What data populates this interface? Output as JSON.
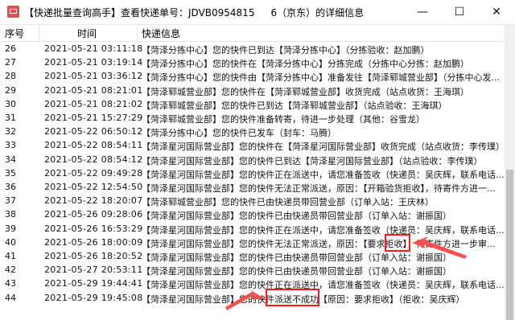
{
  "window": {
    "title_prefix": "【快递批量查询高手】查看快递单号：JDVB0954815",
    "title_suffix": "6（京东）的详细信息",
    "minimize": "—",
    "maximize": "☐",
    "close": "✕"
  },
  "columns": [
    "序号",
    "时间",
    "快递信息"
  ],
  "rows": [
    {
      "no": "26",
      "time": "2021-05-21 03:11:18",
      "info": "【菏泽分拣中心】您的快件已到达【菏泽分拣中心】（分拣验收：赵加鹏）"
    },
    {
      "no": "27",
      "time": "2021-05-21 03:19:14",
      "info": "【菏泽分拣中心】您的快件在【菏泽分拣中心】分拣完成（分拣中心分拣：赵加鹏）"
    },
    {
      "no": "28",
      "time": "2021-05-21 03:36:12",
      "info": "【菏泽分拣中心】您的快件由【菏泽分拣中心】准备发往【菏泽郓城营业部】（分拣中心发..."
    },
    {
      "no": "29",
      "time": "2021-05-21 08:21:01",
      "info": "【菏泽郓城营业部】您的快件在【菏泽郓城营业部】收货完成（站点收货：王海琪）"
    },
    {
      "no": "30",
      "time": "2021-05-21 08:21:02",
      "info": "【菏泽郓城营业部】您的快件已到达【菏泽郓城营业部】（站点验收：王海琪）"
    },
    {
      "no": "31",
      "time": "2021-05-21 15:27:29",
      "info": "【菏泽郓城营业部】您的快件准备转寄，待进一步处理（其他：谷雪龙）"
    },
    {
      "no": "32",
      "time": "2021-05-22 06:50:12",
      "info": "【菏泽分拣中心】您的快件已发车（封车：马腾）"
    },
    {
      "no": "33",
      "time": "2021-05-22 08:54:11",
      "info": "【菏泽星河国际营业部】您的快件在【菏泽星河国际营业部】收货完成（站点收货：李传璞）"
    },
    {
      "no": "34",
      "time": "2021-05-22 08:54:12",
      "info": "【菏泽星河国际营业部】您的快件已到达【菏泽星河国际营业部】（站点验收：李传璞）"
    },
    {
      "no": "35",
      "time": "2021-05-22 09:49:28",
      "info": "【菏泽星河国际营业部】您的快件正在派送中，请您准备签收（快递员：吴庆辉，联系电话..."
    },
    {
      "no": "36",
      "time": "2021-05-22 12:54:50",
      "info": "【菏泽星河国际营业部】您的快件无法正常派送，原因：【开箱验货拒收】，待寄件方进一..."
    },
    {
      "no": "37",
      "time": "2021-05-22 18:20:07",
      "info": "【菏泽郓城营业部】您的快件已由快递员带回营业部（订单入站：王庆林）"
    },
    {
      "no": "38",
      "time": "2021-05-26 09:28:06",
      "info": "【菏泽星河国际营业部】您的快件已由快递员带回营业部（订单入站：谢振国）"
    },
    {
      "no": "39",
      "time": "2021-05-26 16:53:29",
      "info": "【菏泽星河国际营业部】您的快件正在派送中，请您准备签收（快递员：吴庆辉，联系电话..."
    },
    {
      "no": "40",
      "time": "2021-05-26 18:00:09",
      "info": "【菏泽星河国际营业部】您的快件无法正常派送，原因：【要求拒收】，待寄件方进一步审..."
    },
    {
      "no": "41",
      "time": "2021-05-26 18:20:52",
      "info": "【菏泽星河国际营业部】您的快件已由快递员带回营业部（订单入站：谢振国）"
    },
    {
      "no": "42",
      "time": "2021-05-27 20:53:11",
      "info": "【菏泽星河国际营业部】您的快件已由快递员带回营业部（订单入站：谢振国）"
    },
    {
      "no": "43",
      "time": "2021-05-29 19:44:41",
      "info": "【菏泽星河国际营业部】您的快件正在派送中，请您准备签收（快递员：吴庆辉，联系电话..."
    },
    {
      "no": "44",
      "time": "2021-05-29 19:45:08",
      "info": "【菏泽星河国际营业部】您的快件派送不成功【原因：要求拒收】（拒收：吴庆辉）"
    }
  ],
  "colors": {
    "highlight": "#ff1a1a",
    "arrow": "#ff4d4d"
  }
}
